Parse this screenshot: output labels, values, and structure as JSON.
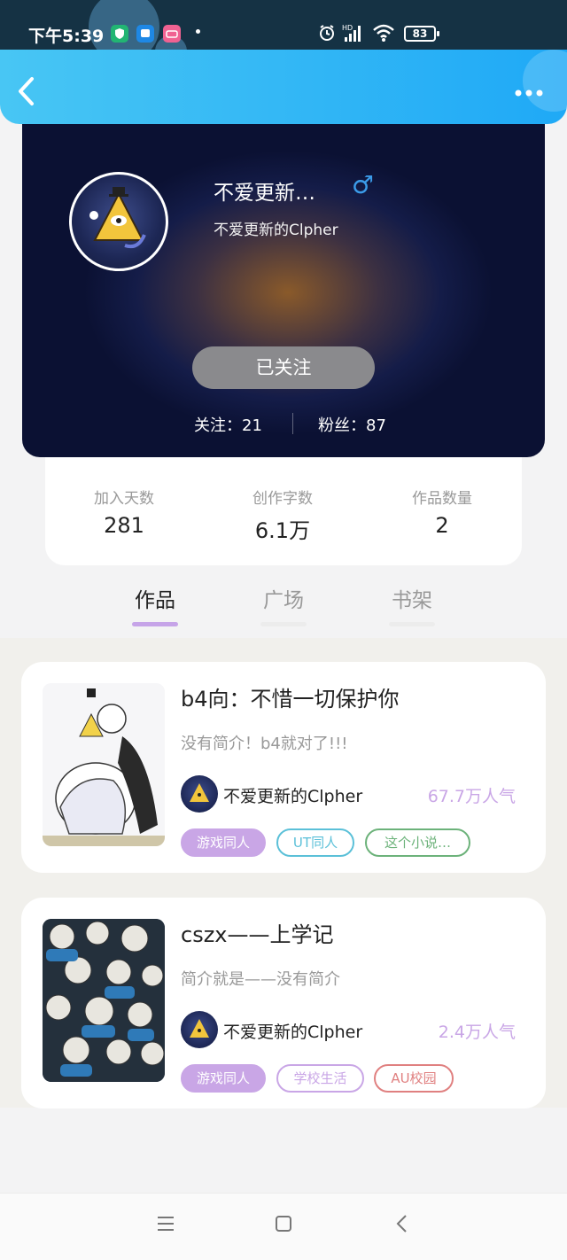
{
  "status_bar": {
    "time": "下午5:39",
    "battery": "83",
    "network": "HD",
    "app_icons": [
      "shield-app-icon",
      "chat-app-icon",
      "bilibili-app-icon"
    ],
    "colors": {
      "background": "#153244"
    }
  },
  "header": {
    "back_icon": "‹",
    "more_icon": "•••",
    "colors": {
      "gradient_start": "#48c6f4",
      "gradient_end": "#1fa9f6"
    }
  },
  "profile": {
    "name": "不爱更新…",
    "gender_symbol": "♂",
    "subtitle": "不爱更新的Clpher",
    "follow_button": "已关注",
    "following": "关注：21",
    "followers": "粉丝：87"
  },
  "stats": [
    {
      "label": "加入天数",
      "value": "281"
    },
    {
      "label": "创作字数",
      "value": "6.1万"
    },
    {
      "label": "作品数量",
      "value": "2"
    }
  ],
  "tabs": [
    {
      "label": "作品",
      "active": true
    },
    {
      "label": "广场",
      "active": false
    },
    {
      "label": "书架",
      "active": false
    }
  ],
  "works": [
    {
      "title": "b4向：不惜一切保护你",
      "description": "没有简介！b4就对了!!!",
      "author": "不爱更新的Clpher",
      "popularity": "67.7万人气",
      "tags": [
        {
          "label": "游戏同人",
          "style": "filled",
          "color": "#c9a6e6"
        },
        {
          "label": "UT同人",
          "style": "outline",
          "color": "#5bc0d8"
        },
        {
          "label": "这个小说…",
          "style": "outline",
          "color": "#6cb27a"
        }
      ]
    },
    {
      "title": "cszx——上学记",
      "description": "简介就是——没有简介",
      "author": "不爱更新的Clpher",
      "popularity": "2.4万人气",
      "tags": [
        {
          "label": "游戏同人",
          "style": "filled",
          "color": "#c9a6e6"
        },
        {
          "label": "学校生活",
          "style": "outline",
          "color": "#c9a6e6"
        },
        {
          "label": "AU校园",
          "style": "outline",
          "color": "#e08080"
        }
      ]
    }
  ],
  "nav": {
    "menu_icon": "☰",
    "home_icon": "▢",
    "back_icon": "‹"
  }
}
